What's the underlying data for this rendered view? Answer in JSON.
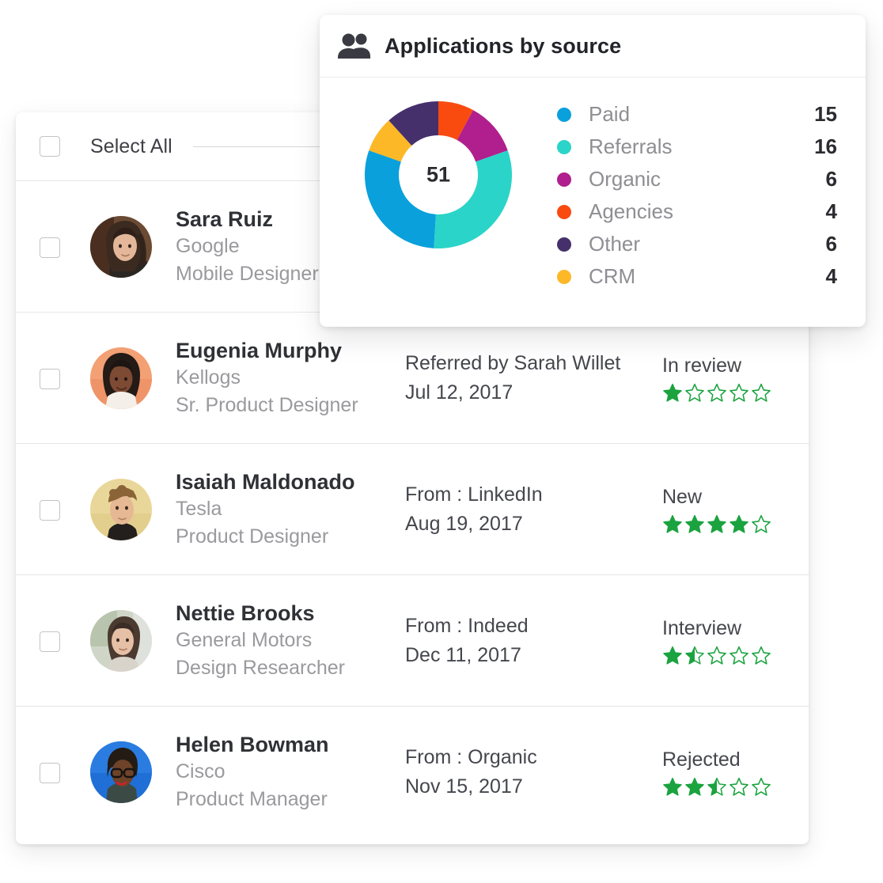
{
  "list": {
    "select_all_label": "Select All",
    "rows": [
      {
        "name": "Sara Ruiz",
        "company": "Google",
        "title": "Mobile Designer",
        "source": "",
        "date": "",
        "status": "",
        "rating": 0
      },
      {
        "name": "Eugenia Murphy",
        "company": "Kellogs",
        "title": "Sr. Product Designer",
        "source": "Referred by Sarah Willet",
        "date": "Jul 12, 2017",
        "status": "In review",
        "rating": 1
      },
      {
        "name": "Isaiah Maldonado",
        "company": "Tesla",
        "title": "Product Designer",
        "source": "From : LinkedIn",
        "date": "Aug 19, 2017",
        "status": "New",
        "rating": 4
      },
      {
        "name": "Nettie Brooks",
        "company": "General Motors",
        "title": "Design Researcher",
        "source": "From : Indeed",
        "date": "Dec 11, 2017",
        "status": "Interview",
        "rating": 1.5
      },
      {
        "name": "Helen Bowman",
        "company": "Cisco",
        "title": "Product Manager",
        "source": "From : Organic",
        "date": "Nov 15, 2017",
        "status": "Rejected",
        "rating": 2.5
      }
    ]
  },
  "chart_card": {
    "title": "Applications by source",
    "icon": "people-icon"
  },
  "chart_data": {
    "type": "pie",
    "title": "Applications by source",
    "center_label": "51",
    "total": 51,
    "start_angle_deg": 0,
    "legend_position": "right",
    "categories": [
      "Paid",
      "Referrals",
      "Organic",
      "Agencies",
      "Other",
      "CRM"
    ],
    "values": [
      15,
      16,
      6,
      4,
      6,
      4
    ],
    "slice_order_clockwise_from_top": [
      "Agencies",
      "Organic",
      "Referrals",
      "Paid",
      "CRM",
      "Other"
    ],
    "colors": {
      "Paid": "#09a0dc",
      "Referrals": "#2bd4c8",
      "Organic": "#b01f8d",
      "Agencies": "#f94b10",
      "Other": "#46306b",
      "CRM": "#fcb827"
    }
  },
  "colors": {
    "star_green": "#1ba33f",
    "card_background": "#ffffff",
    "page_background": "#ffffff",
    "divider": "#e6e6e6",
    "muted_text": "#9a9a9e",
    "body_text": "#45474d"
  }
}
